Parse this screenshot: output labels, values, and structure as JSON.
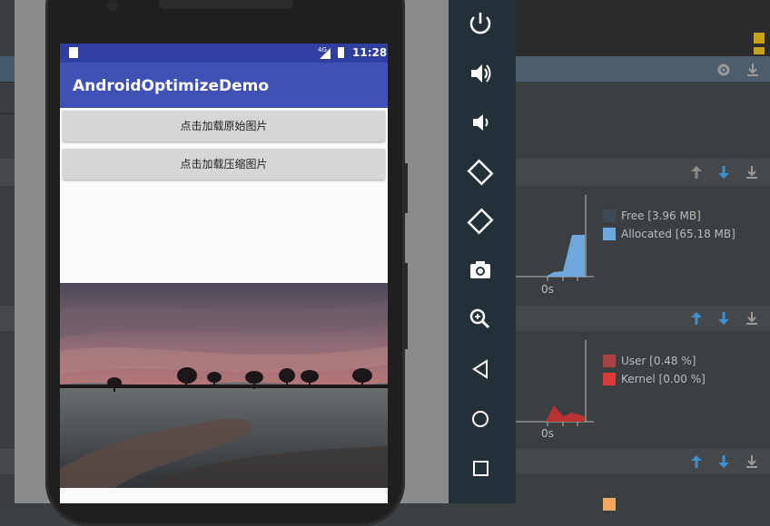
{
  "app": {
    "title": "AndroidOptimizeDemo",
    "status_time": "11:28",
    "network_badge": "4G",
    "buttons": [
      "点击加载原始图片",
      "点击加载压缩图片"
    ],
    "image": "sunset-landscape-photo"
  },
  "emulator_toolbar": {
    "items": [
      "power-icon",
      "volume-up-icon",
      "volume-down-icon",
      "rotate-left-icon",
      "rotate-right-icon",
      "camera-icon",
      "zoom-icon",
      "back-icon",
      "home-icon",
      "overview-icon"
    ]
  },
  "monitors": {
    "memory": {
      "legend": [
        {
          "label": "Free [3.96 MB]",
          "color": "#3e4a55"
        },
        {
          "label": "Allocated [65.18 MB]",
          "color": "#6fa8dc"
        }
      ],
      "x_tick": "0s"
    },
    "cpu": {
      "legend": [
        {
          "label": "User [0.48 %]",
          "color": "#a64242"
        },
        {
          "label": "Kernel [0.00 %]",
          "color": "#d93a3a"
        }
      ],
      "x_tick": "0s"
    }
  },
  "colors": {
    "accent_blue": "#3f51b5",
    "status_blue": "#303f9f",
    "toolbar_bg": "#243037",
    "ide_bg": "#3c3f41"
  }
}
